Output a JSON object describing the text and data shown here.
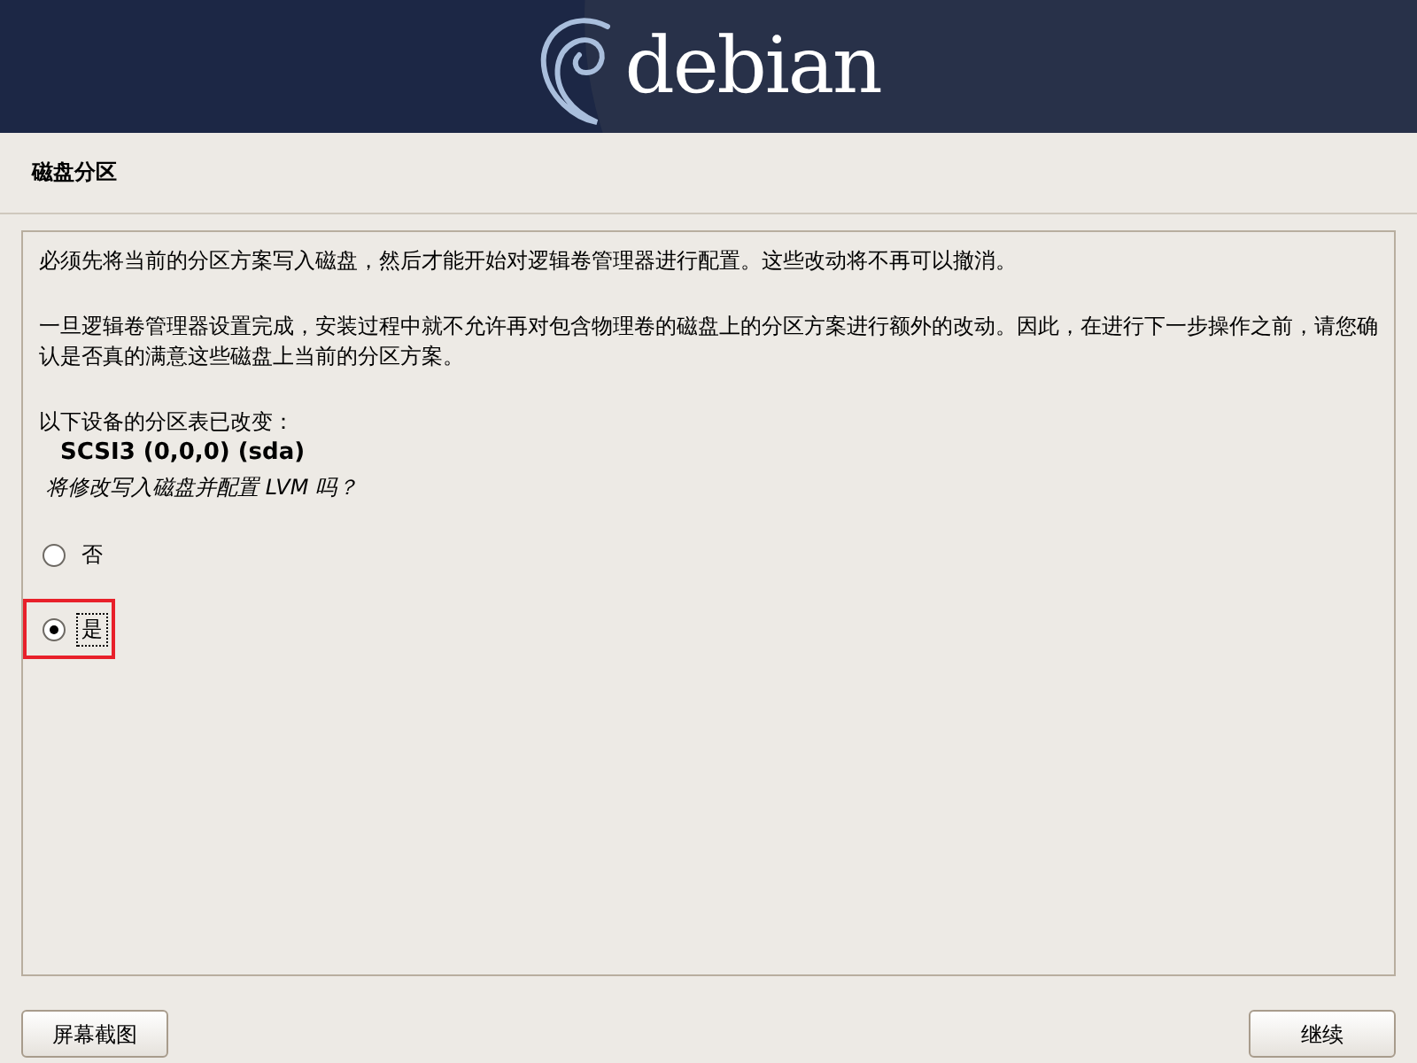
{
  "header": {
    "logo_text": "debian"
  },
  "title": "磁盘分区",
  "paragraphs": [
    "必须先将当前的分区方案写入磁盘，然后才能开始对逻辑卷管理器进行配置。这些改动将不再可以撤消。",
    "一旦逻辑卷管理器设置完成，安装过程中就不允许再对包含物理卷的磁盘上的分区方案进行额外的改动。因此，在进行下一步操作之前，请您确认是否真的满意这些磁盘上当前的分区方案。"
  ],
  "devices_label": "以下设备的分区表已改变：",
  "devices": [
    "SCSI3 (0,0,0) (sda)"
  ],
  "question": "将修改写入磁盘并配置 LVM 吗？",
  "options": [
    {
      "label": "否",
      "selected": false,
      "focused": false,
      "highlighted": false
    },
    {
      "label": "是",
      "selected": true,
      "focused": true,
      "highlighted": true
    }
  ],
  "buttons": {
    "screenshot": "屏幕截图",
    "continue": "继续"
  }
}
